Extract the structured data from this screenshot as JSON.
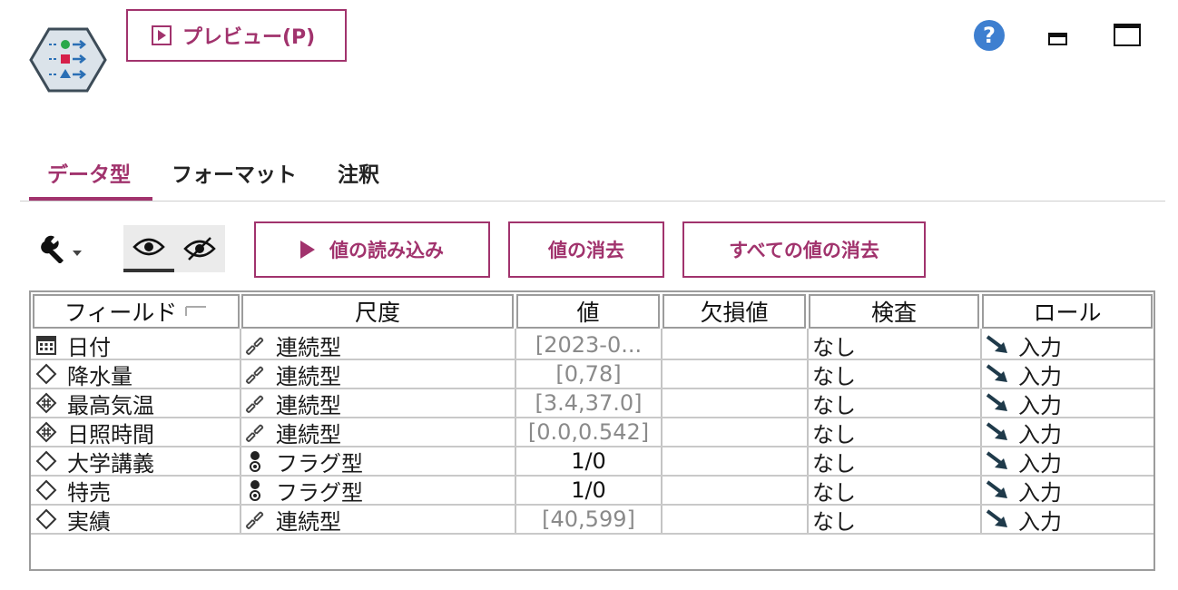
{
  "header": {
    "node_icon": "type-node-icon",
    "preview_label": "プレビュー(P)",
    "help_glyph": "?",
    "minimize_icon": "minimize-icon",
    "maximize_icon": "maximize-icon"
  },
  "tabs": [
    {
      "label": "データ型",
      "active": true
    },
    {
      "label": "フォーマット",
      "active": false
    },
    {
      "label": "注釈",
      "active": false
    }
  ],
  "toolbar": {
    "wrench_icon": "wrench-dropdown-icon",
    "eye_icon": "eye-icon",
    "eye_off_icon": "eye-off-icon",
    "read_values": "値の読み込み",
    "clear_values": "値の消去",
    "clear_all_values": "すべての値の消去"
  },
  "table": {
    "columns": [
      "フィールド",
      "尺度",
      "値",
      "欠損値",
      "検査",
      "ロール"
    ],
    "rows": [
      {
        "icon": "date",
        "field": "日付",
        "measure_icon": "continuous",
        "measure": "連続型",
        "value": "[2023-0...",
        "value_style": "muted",
        "missing": "",
        "check": "なし",
        "role": "入力"
      },
      {
        "icon": "diamond",
        "field": "降水量",
        "measure_icon": "continuous",
        "measure": "連続型",
        "value": "[0,78]",
        "value_style": "muted",
        "missing": "",
        "check": "なし",
        "role": "入力"
      },
      {
        "icon": "diamond-hash",
        "field": "最高気温",
        "measure_icon": "continuous",
        "measure": "連続型",
        "value": "[3.4,37.0]",
        "value_style": "muted",
        "missing": "",
        "check": "なし",
        "role": "入力"
      },
      {
        "icon": "diamond-hash",
        "field": "日照時間",
        "measure_icon": "continuous",
        "measure": "連続型",
        "value": "[0.0,0.542]",
        "value_style": "muted",
        "missing": "",
        "check": "なし",
        "role": "入力"
      },
      {
        "icon": "diamond",
        "field": "大学講義",
        "measure_icon": "flag",
        "measure": "フラグ型",
        "value": "1/0",
        "value_style": "dark",
        "missing": "",
        "check": "なし",
        "role": "入力"
      },
      {
        "icon": "diamond",
        "field": "特売",
        "measure_icon": "flag",
        "measure": "フラグ型",
        "value": "1/0",
        "value_style": "dark",
        "missing": "",
        "check": "なし",
        "role": "入力"
      },
      {
        "icon": "diamond",
        "field": "実績",
        "measure_icon": "continuous",
        "measure": "連続型",
        "value": "[40,599]",
        "value_style": "muted",
        "missing": "",
        "check": "なし",
        "role": "入力"
      }
    ]
  },
  "colors": {
    "accent": "#a1336d",
    "help_blue": "#3e7fd0",
    "role_arrow": "#1f3a4a",
    "grid_line": "#c4c4c4"
  }
}
